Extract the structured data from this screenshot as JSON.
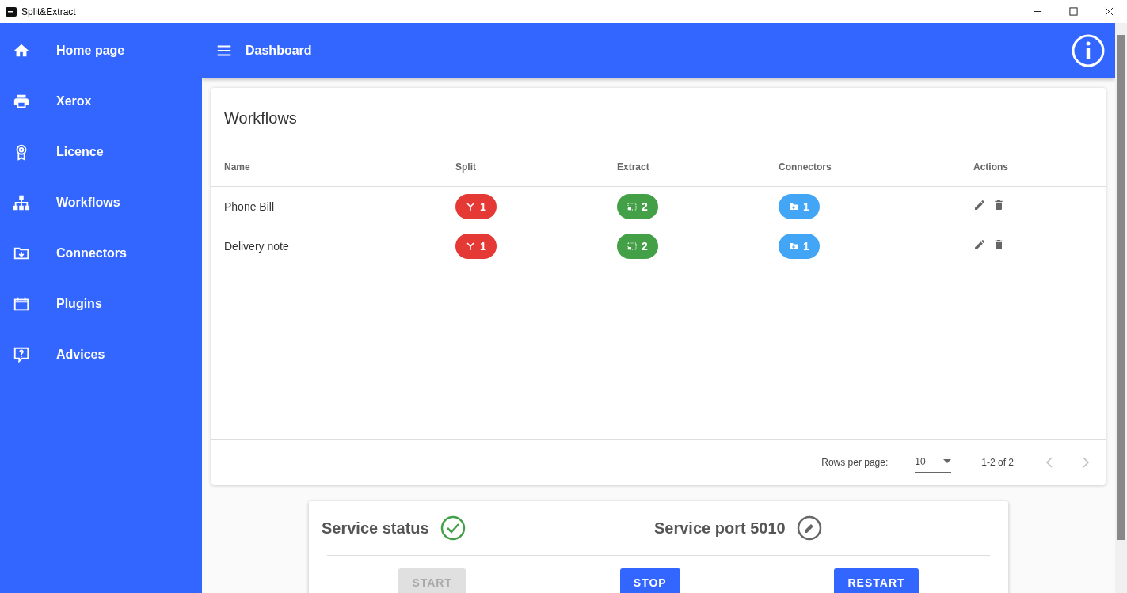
{
  "window": {
    "title": "Split&Extract"
  },
  "sidebar": {
    "items": [
      {
        "label": "Home page"
      },
      {
        "label": "Xerox"
      },
      {
        "label": "Licence"
      },
      {
        "label": "Workflows"
      },
      {
        "label": "Connectors"
      },
      {
        "label": "Plugins"
      },
      {
        "label": "Advices"
      }
    ]
  },
  "header": {
    "title": "Dashboard"
  },
  "workflows": {
    "title": "Workflows",
    "columns": [
      {
        "label": "Name",
        "kind": "text"
      },
      {
        "label": "Split",
        "kind": "split"
      },
      {
        "label": "Extract",
        "kind": "extract"
      },
      {
        "label": "Connectors",
        "kind": "connectors"
      },
      {
        "label": "Actions",
        "kind": "actions"
      }
    ],
    "rows": [
      {
        "cells": [
          "Phone Bill",
          "1",
          "2",
          "1"
        ]
      },
      {
        "cells": [
          "Delivery note",
          "1",
          "2",
          "1"
        ]
      }
    ],
    "pagination": {
      "rows_per_page_label": "Rows per page:",
      "rows_per_page": "10",
      "range": "1-2 of 2"
    }
  },
  "service": {
    "status_label": "Service status",
    "running": true,
    "port_label": "Service port 5010",
    "buttons": [
      {
        "label": "START",
        "disabled": true
      },
      {
        "label": "STOP",
        "disabled": false
      },
      {
        "label": "RESTART",
        "disabled": false
      }
    ]
  }
}
